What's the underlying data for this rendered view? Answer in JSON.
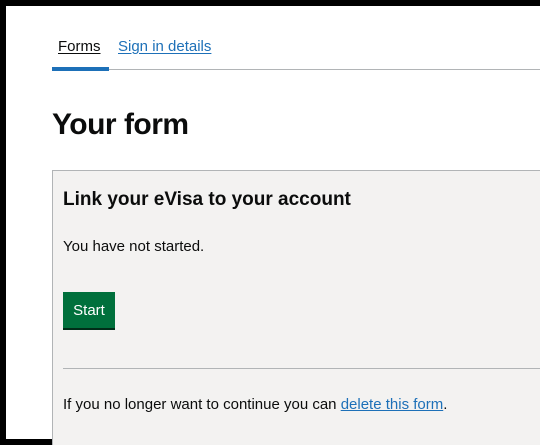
{
  "nav": {
    "tabs": [
      {
        "label": "Forms",
        "active": true
      },
      {
        "label": "Sign in details",
        "active": false
      }
    ]
  },
  "page": {
    "title": "Your form"
  },
  "form_card": {
    "heading": "Link your eVisa to your account",
    "status": "You have not started.",
    "start_label": "Start",
    "footer_prefix": "If you no longer want to continue you can ",
    "delete_link": "delete this form",
    "footer_suffix": "."
  },
  "colors": {
    "link": "#1d70b8",
    "button": "#00703c",
    "panel_bg": "#f3f2f1",
    "text": "#0b0c0c"
  }
}
